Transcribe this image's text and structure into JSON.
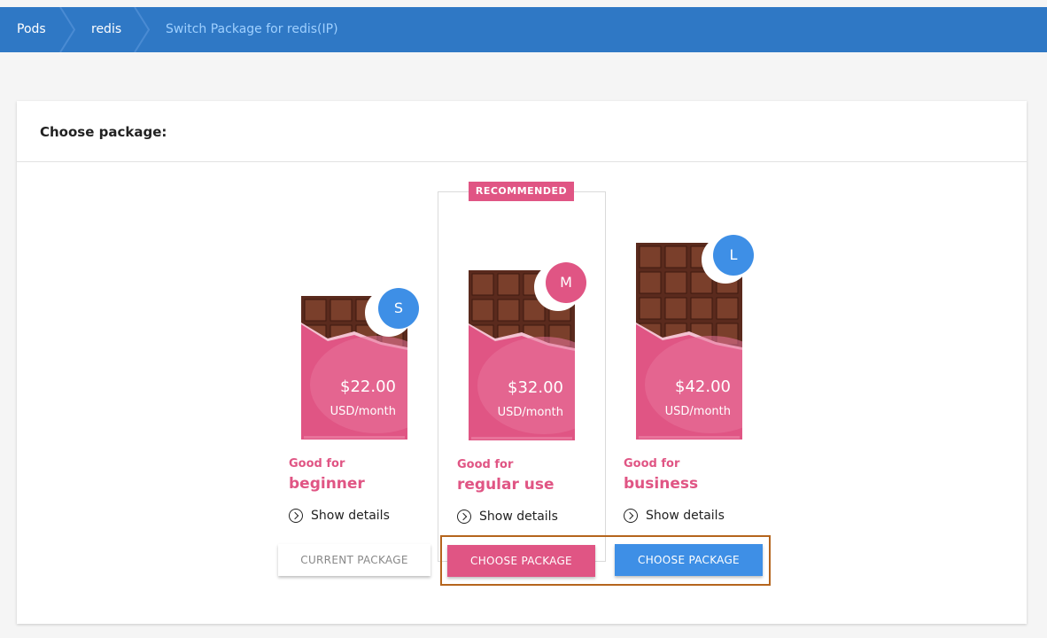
{
  "breadcrumb": {
    "items": [
      "Pods",
      "redis"
    ],
    "current": "Switch Package for redis(IP)"
  },
  "panel": {
    "title": "Choose package:"
  },
  "recommended_label": "RECOMMENDED",
  "packages": [
    {
      "size": "S",
      "price": "$22.00",
      "period": "USD/month",
      "good_for": "Good for",
      "use": "beginner",
      "details": "Show details",
      "button": "CURRENT PACKAGE"
    },
    {
      "size": "M",
      "price": "$32.00",
      "period": "USD/month",
      "good_for": "Good for",
      "use": "regular use",
      "details": "Show details",
      "button": "CHOOSE PACKAGE"
    },
    {
      "size": "L",
      "price": "$42.00",
      "period": "USD/month",
      "good_for": "Good for",
      "use": "business",
      "details": "Show details",
      "button": "CHOOSE PACKAGE"
    }
  ],
  "colors": {
    "header": "#2f78c5",
    "accent_pink": "#e05584",
    "accent_blue": "#3e8fe6",
    "chocolate": "#5a2a1d",
    "highlight_border": "#b5651d"
  }
}
